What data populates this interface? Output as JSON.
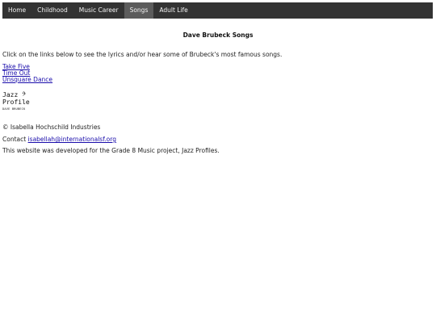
{
  "nav": {
    "items": [
      {
        "label": "Home"
      },
      {
        "label": "Childhood"
      },
      {
        "label": "Music Career"
      },
      {
        "label": "Songs"
      },
      {
        "label": "Adult Life"
      }
    ],
    "active": "Songs",
    "background_color": "#333333",
    "active_color": "#5c5c5c"
  },
  "main": {
    "title": "Dave Brubeck Songs",
    "intro": "Click on the links below to see the lyrics and/or hear some of Brubeck's most famous songs.",
    "songs": [
      {
        "label": "Take Five"
      },
      {
        "label": "Time Out"
      },
      {
        "label": "Unsquare Dance"
      }
    ]
  },
  "logo": {
    "line1": "Jazz",
    "glyph": "𝄢",
    "line2": "Profile",
    "line3": "DAVE BRUBECK"
  },
  "footer": {
    "copyright": "© Isabella Hochschild Industries",
    "contact_label": "Contact ",
    "contact_email": "isabellah@internationalsf.org",
    "developed_note": "This website was developed for the Grade 8 Music project, Jazz Profiles."
  },
  "colors": {
    "link": "#1a0dab"
  }
}
